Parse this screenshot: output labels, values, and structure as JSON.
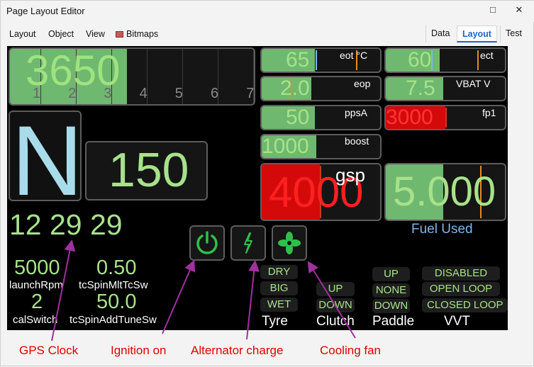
{
  "window": {
    "title": "Page Layout Editor",
    "minimize_glyph": "□",
    "close_glyph": "✕"
  },
  "menu": {
    "layout": "Layout",
    "object": "Object",
    "view": "View",
    "bitmaps": "Bitmaps"
  },
  "tabs": {
    "data": "Data",
    "layout": "Layout",
    "test": "Test",
    "active": "Layout"
  },
  "dash": {
    "rpm": {
      "value": "3650",
      "gears": [
        "1",
        "2",
        "3",
        "4",
        "5",
        "6",
        "7"
      ],
      "fill_fraction": 0.48
    },
    "gear": "N",
    "speed": "150",
    "gauges": [
      {
        "id": "eot",
        "value": "65",
        "label": "eot °C",
        "fill_fraction": 0.45
      },
      {
        "id": "ect",
        "value": "60",
        "label": "ect",
        "fill_fraction": 0.45
      },
      {
        "id": "eop",
        "value": "2.0",
        "label": "eop",
        "fill_fraction": 0.42
      },
      {
        "id": "vbat",
        "value": "7.5",
        "label": "VBAT V",
        "fill_fraction": 0.48
      },
      {
        "id": "pps",
        "value": "50",
        "label": "ppsA",
        "fill_fraction": 0.45
      },
      {
        "id": "fp1",
        "value": "3000",
        "label": "fp1",
        "fill_fraction": 0.5
      },
      {
        "id": "boost",
        "value": "1000",
        "label": "boost",
        "fill_fraction": 0.46
      }
    ],
    "gsp": {
      "value": "4000",
      "label": "gsp",
      "fill_fraction": 0.49
    },
    "fuel": {
      "value": "5.000",
      "label": "Fuel Used",
      "fill_fraction": 0.48
    },
    "clock": "12 29 29",
    "params": [
      {
        "value": "5000",
        "label": "launchRpm"
      },
      {
        "value": "0.50",
        "label": "tcSpinMltTcSw"
      },
      {
        "value": "2",
        "label": "calSwitch"
      },
      {
        "value": "50.0",
        "label": "tcSpinAddTuneSw"
      }
    ],
    "tyre": {
      "options": [
        "DRY",
        "BIG",
        "WET"
      ],
      "label": "Tyre"
    },
    "clutch": {
      "options": [
        "UP",
        "DOWN"
      ],
      "label": "Clutch"
    },
    "paddle": {
      "options": [
        "UP",
        "NONE",
        "DOWN"
      ],
      "label": "Paddle"
    },
    "vvt": {
      "options": [
        "DISABLED",
        "OPEN LOOP",
        "CLOSED LOOP"
      ],
      "label": "VVT"
    }
  },
  "annotations": {
    "gps": "GPS Clock",
    "ignition": "Ignition on",
    "alternator": "Alternator charge",
    "fan": "Cooling fan"
  },
  "colors": {
    "green": "#a7e28a",
    "fill_green": "#6fb86f",
    "red": "#d40a0a",
    "marker": "#e88b1f",
    "annotation": "#e00000",
    "arrow": "#a0309e",
    "active_tab": "#1a66c9"
  }
}
